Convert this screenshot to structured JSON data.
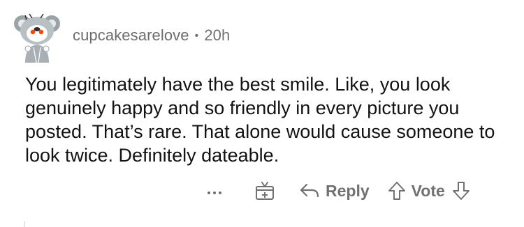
{
  "comment": {
    "author": "cupcakesarelove",
    "separator": "•",
    "time": "20h",
    "text": "You legitimately have the best smile. Like, you look genuinely happy and so friendly in every picture you posted. That’s rare. That alone would cause someone to look twice. Definitely dateable."
  },
  "actions": {
    "more_icon": "more-options-icon",
    "award_icon": "award-icon",
    "reply_icon": "reply-arrow-icon",
    "reply_label": "Reply",
    "upvote_icon": "upvote-arrow-icon",
    "vote_label": "Vote",
    "downvote_icon": "downvote-arrow-icon"
  },
  "colors": {
    "text": "#111315",
    "muted": "#6f7173",
    "avatar_red": "#ff4500"
  }
}
